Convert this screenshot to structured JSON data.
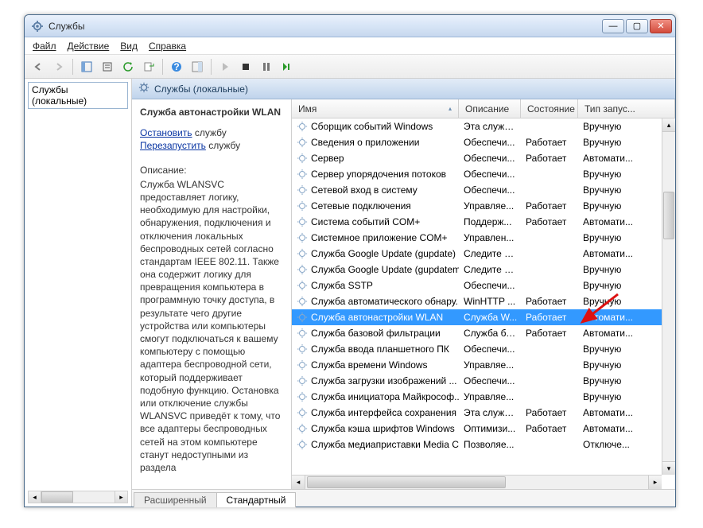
{
  "window": {
    "title": "Службы"
  },
  "menu": {
    "file": "Файл",
    "action": "Действие",
    "view": "Вид",
    "help": "Справка"
  },
  "tree": {
    "root": "Службы (локальные)"
  },
  "header": {
    "caption": "Службы (локальные)"
  },
  "details": {
    "title": "Служба автонастройки WLAN",
    "stop_link": "Остановить",
    "stop_rest": " службу",
    "restart_link": "Перезапустить",
    "restart_rest": " службу",
    "desc_label": "Описание:",
    "desc_body": "Служба WLANSVC предоставляет логику, необходимую для настройки, обнаружения, подключения и отключения локальных беспроводных сетей согласно стандартам IEEE 802.11. Также она содержит логику для превращения компьютера в программную точку доступа, в результате чего другие устройства или компьютеры смогут подключаться к вашему компьютеру с помощью адаптера беспроводной сети, который поддерживает подобную функцию. Остановка или отключение службы WLANSVC приведёт к тому, что все адаптеры беспроводных сетей на этом компьютере станут недоступными из раздела"
  },
  "columns": {
    "name": "Имя",
    "desc": "Описание",
    "state": "Состояние",
    "start": "Тип запус..."
  },
  "rows": [
    {
      "name": "Сборщик событий Windows",
      "desc": "Эта служб...",
      "state": "",
      "start": "Вручную"
    },
    {
      "name": "Сведения о приложении",
      "desc": "Обеспечи...",
      "state": "Работает",
      "start": "Вручную"
    },
    {
      "name": "Сервер",
      "desc": "Обеспечи...",
      "state": "Работает",
      "start": "Автомати..."
    },
    {
      "name": "Сервер упорядочения потоков",
      "desc": "Обеспечи...",
      "state": "",
      "start": "Вручную"
    },
    {
      "name": "Сетевой вход в систему",
      "desc": "Обеспечи...",
      "state": "",
      "start": "Вручную"
    },
    {
      "name": "Сетевые подключения",
      "desc": "Управляе...",
      "state": "Работает",
      "start": "Вручную"
    },
    {
      "name": "Система событий COM+",
      "desc": "Поддерж...",
      "state": "Работает",
      "start": "Автомати..."
    },
    {
      "name": "Системное приложение COM+",
      "desc": "Управлен...",
      "state": "",
      "start": "Вручную"
    },
    {
      "name": "Служба Google Update (gupdate)",
      "desc": "Следите за...",
      "state": "",
      "start": "Автомати..."
    },
    {
      "name": "Служба Google Update (gupdatem)",
      "desc": "Следите за...",
      "state": "",
      "start": "Вручную"
    },
    {
      "name": "Служба SSTP",
      "desc": "Обеспечи...",
      "state": "",
      "start": "Вручную"
    },
    {
      "name": "Служба автоматического обнару...",
      "desc": "WinHTTP ...",
      "state": "Работает",
      "start": "Вручную"
    },
    {
      "name": "Служба автонастройки WLAN",
      "desc": "Служба W...",
      "state": "Работает",
      "start": "Автомати...",
      "selected": true
    },
    {
      "name": "Служба базовой фильтрации",
      "desc": "Служба ба...",
      "state": "Работает",
      "start": "Автомати..."
    },
    {
      "name": "Служба ввода планшетного ПК",
      "desc": "Обеспечи...",
      "state": "",
      "start": "Вручную"
    },
    {
      "name": "Служба времени Windows",
      "desc": "Управляе...",
      "state": "",
      "start": "Вручную"
    },
    {
      "name": "Служба загрузки изображений ...",
      "desc": "Обеспечи...",
      "state": "",
      "start": "Вручную"
    },
    {
      "name": "Служба инициатора Майкрософ...",
      "desc": "Управляе...",
      "state": "",
      "start": "Вручную"
    },
    {
      "name": "Служба интерфейса сохранения ...",
      "desc": "Эта служб...",
      "state": "Работает",
      "start": "Автомати..."
    },
    {
      "name": "Служба кэша шрифтов Windows",
      "desc": "Оптимизи...",
      "state": "Работает",
      "start": "Автомати..."
    },
    {
      "name": "Служба медиаприставки Media C...",
      "desc": "Позволяе...",
      "state": "",
      "start": "Отключе..."
    }
  ],
  "tabs": {
    "extended": "Расширенный",
    "standard": "Стандартный"
  }
}
